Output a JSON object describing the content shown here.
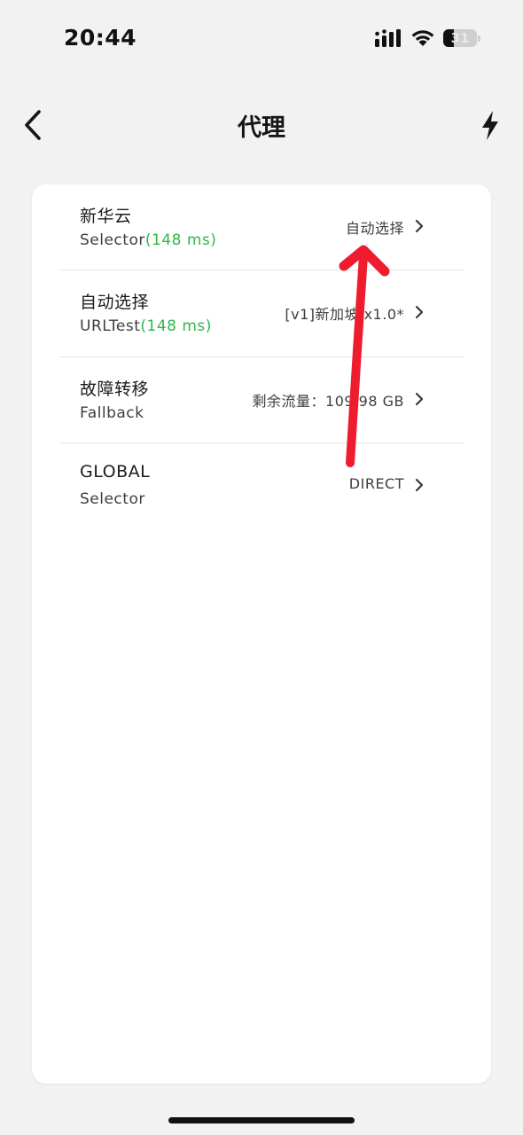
{
  "status_bar": {
    "time": "20:44",
    "battery_level": "31",
    "battery_fraction": 0.31
  },
  "nav": {
    "title": "代理",
    "back_icon": "chevron-left-icon",
    "action_icon": "lightning-bolt-icon"
  },
  "proxy_groups": [
    {
      "name": "新华云",
      "type": "Selector",
      "latency": "(148 ms)",
      "selected": "自动选择"
    },
    {
      "name": "自动选择",
      "type": "URLTest",
      "latency": "(148 ms)",
      "selected": "[v1]新加坡 x1.0*"
    },
    {
      "name": "故障转移",
      "type": "Fallback",
      "latency": "",
      "selected": "剩余流量：109.98 GB"
    },
    {
      "name": "GLOBAL",
      "type": "Selector",
      "latency": "",
      "selected": "DIRECT"
    }
  ],
  "colors": {
    "background": "#f2f2f2",
    "card": "#ffffff",
    "latency_green": "#2db84b",
    "annotation_red": "#ee1c2e"
  }
}
